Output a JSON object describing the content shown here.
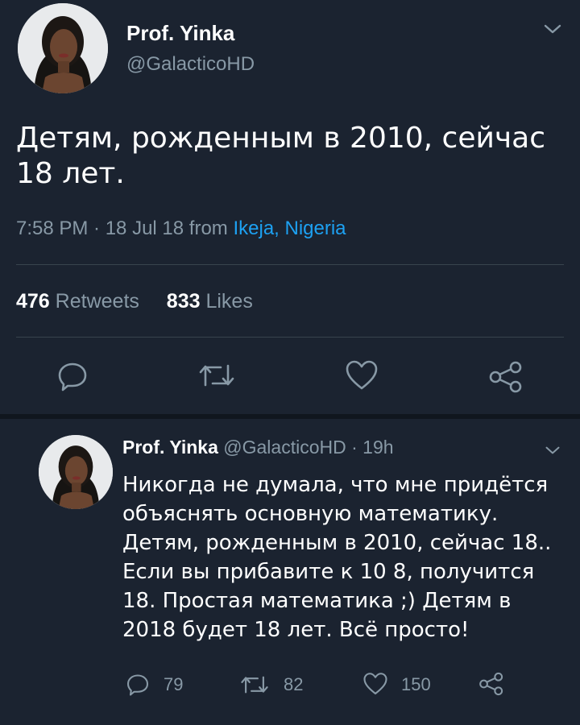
{
  "main_tweet": {
    "display_name": "Prof. Yinka",
    "handle": "@GalacticoHD",
    "text": "Детям, рожденным в 2010, сейчас 18 лет.",
    "time": "7:58 PM · 18 Jul 18",
    "from_label": "from",
    "location": "Ikeja, Nigeria",
    "retweets_count": "476",
    "retweets_label": "Retweets",
    "likes_count": "833",
    "likes_label": "Likes"
  },
  "reply": {
    "display_name": "Prof. Yinka",
    "handle": "@GalacticoHD",
    "age": "· 19h",
    "text": "Никогда не думала, что мне придётся объяснять основную математику. Детям, рожденным в 2010, сейчас 18.. Если вы прибавите к 10 8, получится 18. Простая математика ;) Детям в 2018 будет 18 лет. Всё просто!",
    "reply_count": "79",
    "retweet_count": "82",
    "like_count": "150"
  },
  "icons": {
    "reply": "reply-icon",
    "retweet": "retweet-icon",
    "like": "heart-icon",
    "share": "share-icon",
    "menu": "chevron-down-icon"
  },
  "colors": {
    "background": "#1b2330",
    "text_primary": "#ffffff",
    "text_secondary": "#8899a6",
    "link": "#1da1f2",
    "divider": "#38444d"
  }
}
